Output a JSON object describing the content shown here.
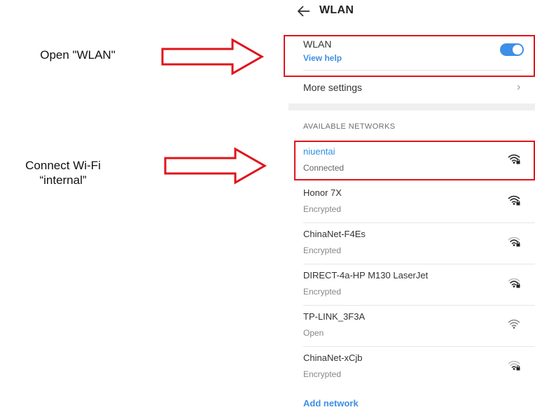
{
  "annotations": {
    "open_wlan": "Open \"WLAN\"",
    "connect_wifi_line1": "Connect Wi-Fi",
    "connect_wifi_line2": "“internal”"
  },
  "header": {
    "back_icon": "back-arrow-icon",
    "title": "WLAN"
  },
  "wlan_toggle": {
    "label": "WLAN",
    "help_link": "View help",
    "state": "on"
  },
  "more_settings": {
    "label": "More settings",
    "chevron": "›"
  },
  "available_networks": {
    "header": "AVAILABLE NETWORKS",
    "items": [
      {
        "name": "niuentai",
        "status": "Connected",
        "icon": "wifi-locked-icon"
      },
      {
        "name": "Honor 7X",
        "status": "Encrypted",
        "icon": "wifi-locked-icon"
      },
      {
        "name": "ChinaNet-F4Es",
        "status": "Encrypted",
        "icon": "wifi-locked-icon"
      },
      {
        "name": "DIRECT-4a-HP M130 LaserJet",
        "status": "Encrypted",
        "icon": "wifi-locked-icon"
      },
      {
        "name": "TP-LINK_3F3A",
        "status": "Open",
        "icon": "wifi-icon"
      },
      {
        "name": "ChinaNet-xCjb",
        "status": "Encrypted",
        "icon": "wifi-locked-icon"
      }
    ]
  },
  "add_network": "Add network",
  "colors": {
    "accent": "#3e8fe6",
    "highlight": "#e0141b"
  }
}
